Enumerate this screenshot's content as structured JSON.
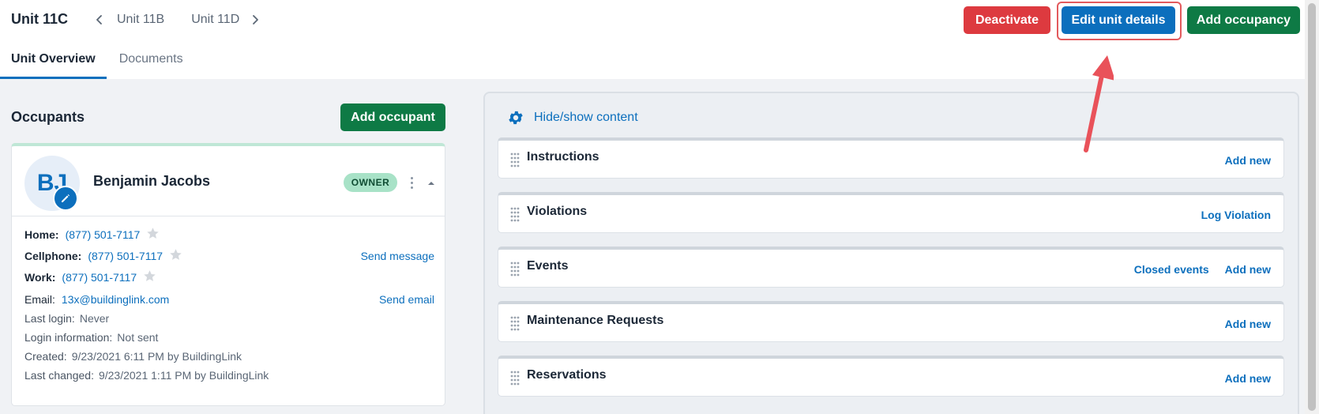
{
  "header": {
    "unit_title": "Unit 11C",
    "prev_unit": "Unit 11B",
    "next_unit": "Unit 11D",
    "buttons": {
      "deactivate": "Deactivate",
      "edit_unit": "Edit unit details",
      "add_occupancy": "Add occupancy"
    },
    "tabs": [
      {
        "label": "Unit Overview",
        "active": true
      },
      {
        "label": "Documents",
        "active": false
      }
    ]
  },
  "occupants": {
    "title": "Occupants",
    "add_button": "Add occupant",
    "card": {
      "initials": "BJ",
      "name": "Benjamin Jacobs",
      "badge": "OWNER",
      "home_label": "Home:",
      "home_phone": "(877) 501-7117",
      "cell_label": "Cellphone:",
      "cell_phone": "(877) 501-7117",
      "work_label": "Work:",
      "work_phone": "(877) 501-7117",
      "send_message": "Send message",
      "email_label": "Email:",
      "email": "13x@buildinglink.com",
      "send_email": "Send email",
      "last_login_label": "Last login:",
      "last_login": "Never",
      "login_info_label": "Login information:",
      "login_info": "Not sent",
      "created_label": "Created:",
      "created": "9/23/2021 6:11 PM by BuildingLink",
      "changed_label": "Last changed:",
      "changed": "9/23/2021 1:11 PM by BuildingLink"
    }
  },
  "content_panel": {
    "hide_show": "Hide/show content",
    "widgets": [
      {
        "title": "Instructions",
        "actions": [
          "Add new"
        ]
      },
      {
        "title": "Violations",
        "actions": [
          "Log Violation"
        ]
      },
      {
        "title": "Events",
        "actions": [
          "Closed events",
          "Add new"
        ]
      },
      {
        "title": "Maintenance Requests",
        "actions": [
          "Add new"
        ]
      },
      {
        "title": "Reservations",
        "actions": [
          "Add new"
        ]
      }
    ]
  },
  "colors": {
    "primary_blue": "#0c6fbd",
    "danger_red": "#dd3a3f",
    "success_green": "#0e7a45",
    "owner_badge": "#a8e2c7",
    "annotation_red": "#e35a5d"
  },
  "icons": [
    "chevron-left-icon",
    "chevron-right-icon",
    "pencil-icon",
    "star-icon",
    "kebab-menu-icon",
    "chevron-up-icon",
    "gear-icon",
    "drag-handle-icon"
  ]
}
